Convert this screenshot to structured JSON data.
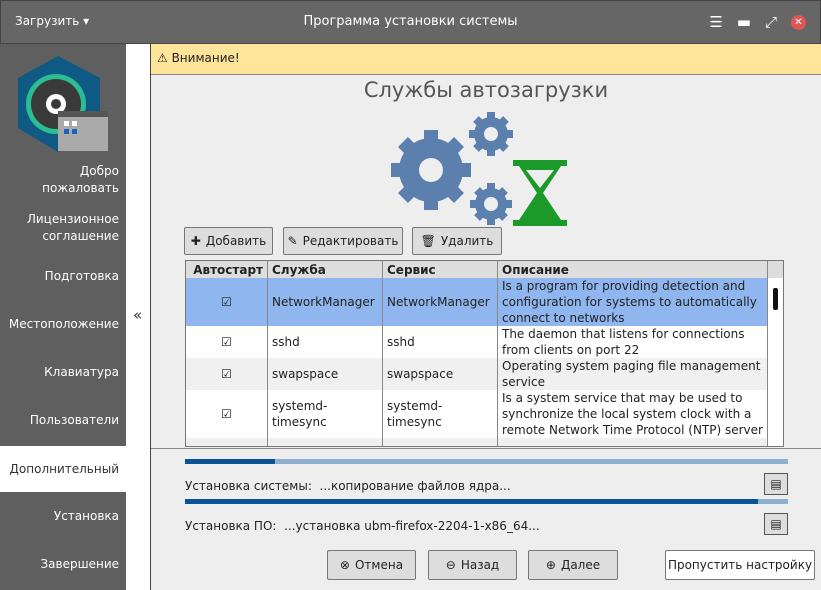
{
  "titlebar": {
    "menu": "Загрузить ▾",
    "title": "Программа установки системы"
  },
  "sidebar": {
    "items": [
      {
        "label": "Добро пожаловать"
      },
      {
        "label": "Лицензионное соглашение"
      },
      {
        "label": "Подготовка"
      },
      {
        "label": "Местоположение"
      },
      {
        "label": "Клавиатура"
      },
      {
        "label": "Пользователи"
      },
      {
        "label": "Дополнительный",
        "active": true
      },
      {
        "label": "Установка"
      },
      {
        "label": "Завершение"
      }
    ],
    "collapse": "«"
  },
  "warning": "Внимание!",
  "heading": "Службы автозагрузки",
  "toolbar": {
    "add": "Добавить",
    "edit": "Редактировать",
    "delete": "Удалить"
  },
  "table": {
    "headers": [
      "Автостарт",
      "Служба",
      "Сервис",
      "Описание"
    ],
    "rows": [
      {
        "autostart": "☑",
        "service": "NetworkManager",
        "unit": "NetworkManager",
        "desc": "Is a program for providing detection and configuration for systems to automatically connect to networks"
      },
      {
        "autostart": "☑",
        "service": "sshd",
        "unit": "sshd",
        "desc": "The daemon that listens for connections from clients on port 22"
      },
      {
        "autostart": "☑",
        "service": "swapspace",
        "unit": "swapspace",
        "desc": "Operating system paging file management service"
      },
      {
        "autostart": "☑",
        "service": "systemd-timesync",
        "unit": "systemd-timesync",
        "desc": "Is a system service that may be used to synchronize the local system clock with a remote Network Time Protocol (NTP) server"
      }
    ]
  },
  "progress": {
    "system": {
      "label": "Установка системы:",
      "status": "...копирование файлов ядра...",
      "percent": 15
    },
    "software": {
      "label": "Установка ПО:",
      "status": "...установка ubm-firefox-2204-1-x86_64...",
      "percent": 95
    }
  },
  "buttons": {
    "cancel": "Отмена",
    "back": "Назад",
    "next": "Далее",
    "skip": "Пропустить настройку"
  },
  "colors": {
    "accent": "#0b5394",
    "selection": "#8fb6ee",
    "warning": "#ffe59a",
    "gear": "#5b80ad",
    "hourglass": "#1b9a2a"
  }
}
